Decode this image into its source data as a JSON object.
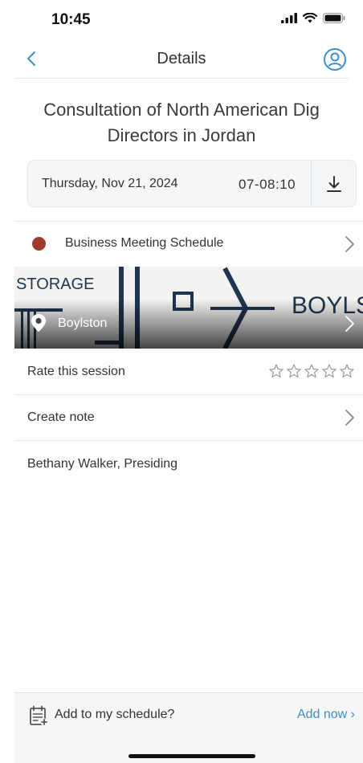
{
  "status_bar": {
    "time": "10:45"
  },
  "nav": {
    "title": "Details",
    "back_icon": "chevron-left-icon",
    "profile_icon": "user-circle-icon"
  },
  "session": {
    "title": "Consultation of North American Dig Directors in Jordan"
  },
  "schedule": {
    "date": "Thursday, Nov 21, 2024",
    "time": "07-08:10"
  },
  "track": {
    "label": "Business Meeting Schedule",
    "color": "#a23a2b"
  },
  "location": {
    "name": "Boylston",
    "image_text_left": "STORAGE",
    "image_text_right": "BOYLS"
  },
  "rating": {
    "label": "Rate this session",
    "stars": 5,
    "value": 0
  },
  "note": {
    "label": "Create note"
  },
  "presiding": {
    "text": "Bethany Walker, Presiding"
  },
  "bottom_bar": {
    "prompt": "Add to my schedule?",
    "action": "Add now ›",
    "accent": "#3a8fcc"
  }
}
